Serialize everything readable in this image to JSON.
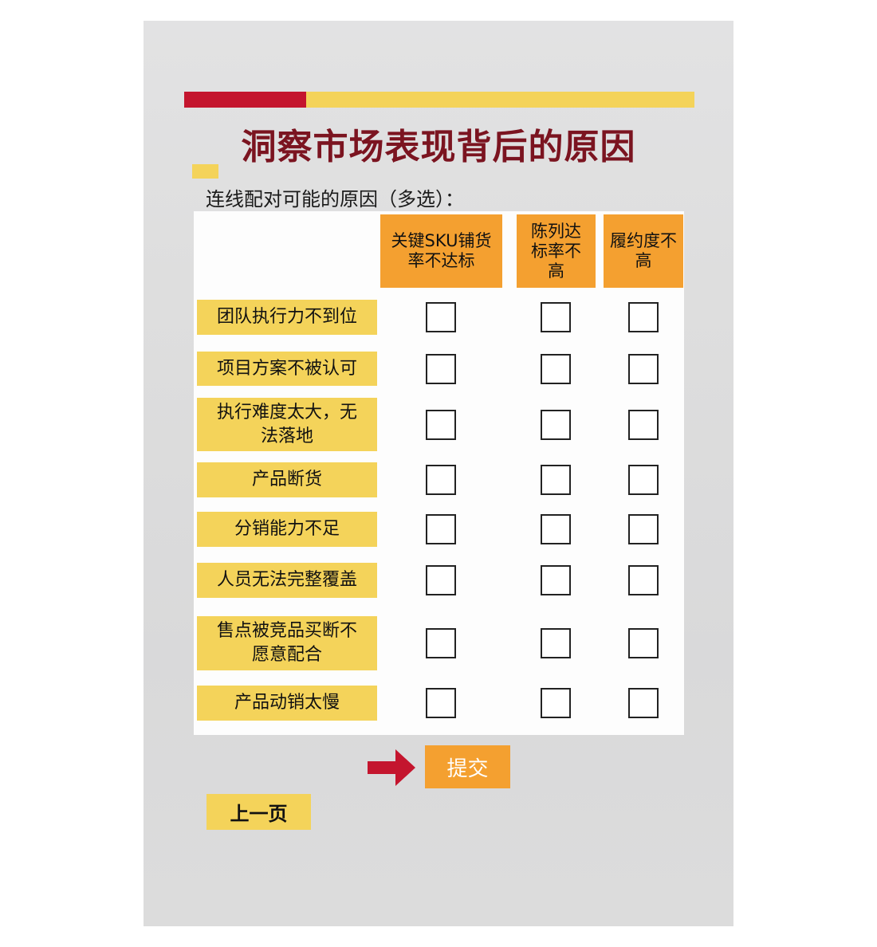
{
  "title": "洞察市场表现背后的原因",
  "subtitle": "连线配对可能的原因（多选）：",
  "columns": [
    {
      "label": "关键SKU铺货率不达标"
    },
    {
      "label": "陈列达标率不高"
    },
    {
      "label": "履约度不高"
    }
  ],
  "rows": [
    {
      "label": "团队执行力不到位",
      "checked": [
        false,
        false,
        false
      ]
    },
    {
      "label": "项目方案不被认可",
      "checked": [
        false,
        false,
        false
      ]
    },
    {
      "label": "执行难度太大，无法落地",
      "checked": [
        false,
        false,
        false
      ]
    },
    {
      "label": "产品断货",
      "checked": [
        false,
        false,
        false
      ]
    },
    {
      "label": "分销能力不足",
      "checked": [
        false,
        false,
        false
      ]
    },
    {
      "label": "人员无法完整覆盖",
      "checked": [
        false,
        false,
        false
      ]
    },
    {
      "label": "售点被竞品买断不愿意配合",
      "checked": [
        false,
        false,
        false
      ]
    },
    {
      "label": "产品动销太慢",
      "checked": [
        false,
        false,
        false
      ]
    }
  ],
  "submit_label": "提交",
  "prev_label": "上一页",
  "colors": {
    "brand_red": "#c4152e",
    "title": "#7b1420",
    "yellow": "#f4d35a",
    "orange": "#f4a030"
  }
}
